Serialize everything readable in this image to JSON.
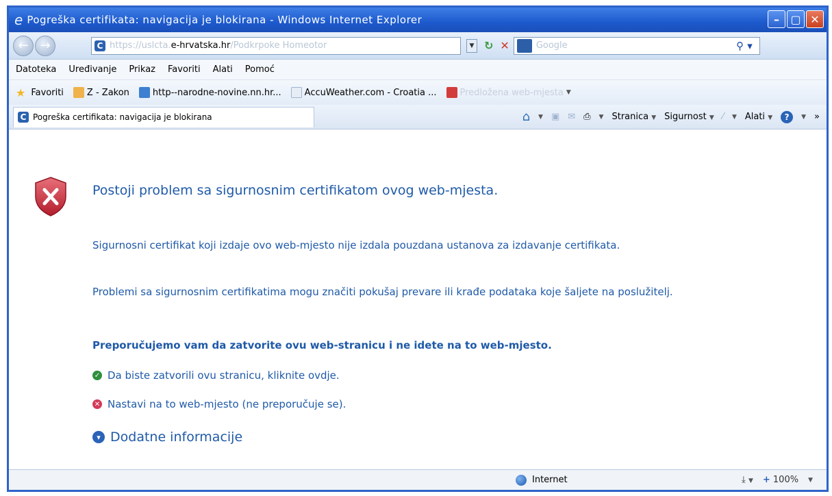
{
  "window": {
    "title": "Pogreška certifikata: navigacija je blokirana - Windows Internet Explorer",
    "buttons": {
      "minimize": "–",
      "maximize": "▢",
      "close": "✕"
    }
  },
  "address_bar": {
    "url_prefix": "https://uslcta.",
    "url_host": "e-hrvatska.hr",
    "url_suffix": "/Podkrpoke Homeotor"
  },
  "search": {
    "placeholder": "Google"
  },
  "menu": [
    "Datoteka",
    "Uređivanje",
    "Prikaz",
    "Favoriti",
    "Alati",
    "Pomoć"
  ],
  "favorites": {
    "label": "Favoriti",
    "items": [
      {
        "label": "Z - Zakon"
      },
      {
        "label": "http--narodne-novine.nn.hr..."
      },
      {
        "label": "AccuWeather.com - Croatia ..."
      },
      {
        "label": "Predložena web-mjesta"
      }
    ]
  },
  "tab": {
    "label": "Pogreška certifikata: navigacija je blokirana"
  },
  "command_bar": {
    "page": "Stranica",
    "safety": "Sigurnost",
    "tools": "Alati",
    "more": "»"
  },
  "content": {
    "headline": "Postoji problem sa sigurnosnim certifikatom ovog web-mjesta.",
    "para1": "Sigurnosni certifikat koji izdaje ovo web-mjesto nije izdala pouzdana ustanova za izdavanje certifikata.",
    "para2": "Problemi sa sigurnosnim certifikatima mogu značiti pokušaj prevare ili krađe podataka koje šaljete na poslužitelj.",
    "recommend": "Preporučujemo vam da zatvorite ovu web-stranicu i ne idete na to web-mjesto.",
    "close_link": "Da biste zatvorili ovu stranicu, kliknite ovdje.",
    "continue_link": "Nastavi na to web-mjesto (ne preporučuje se).",
    "more_info": "Dodatne informacije"
  },
  "status": {
    "zone": "Internet",
    "zoom": "100%"
  }
}
